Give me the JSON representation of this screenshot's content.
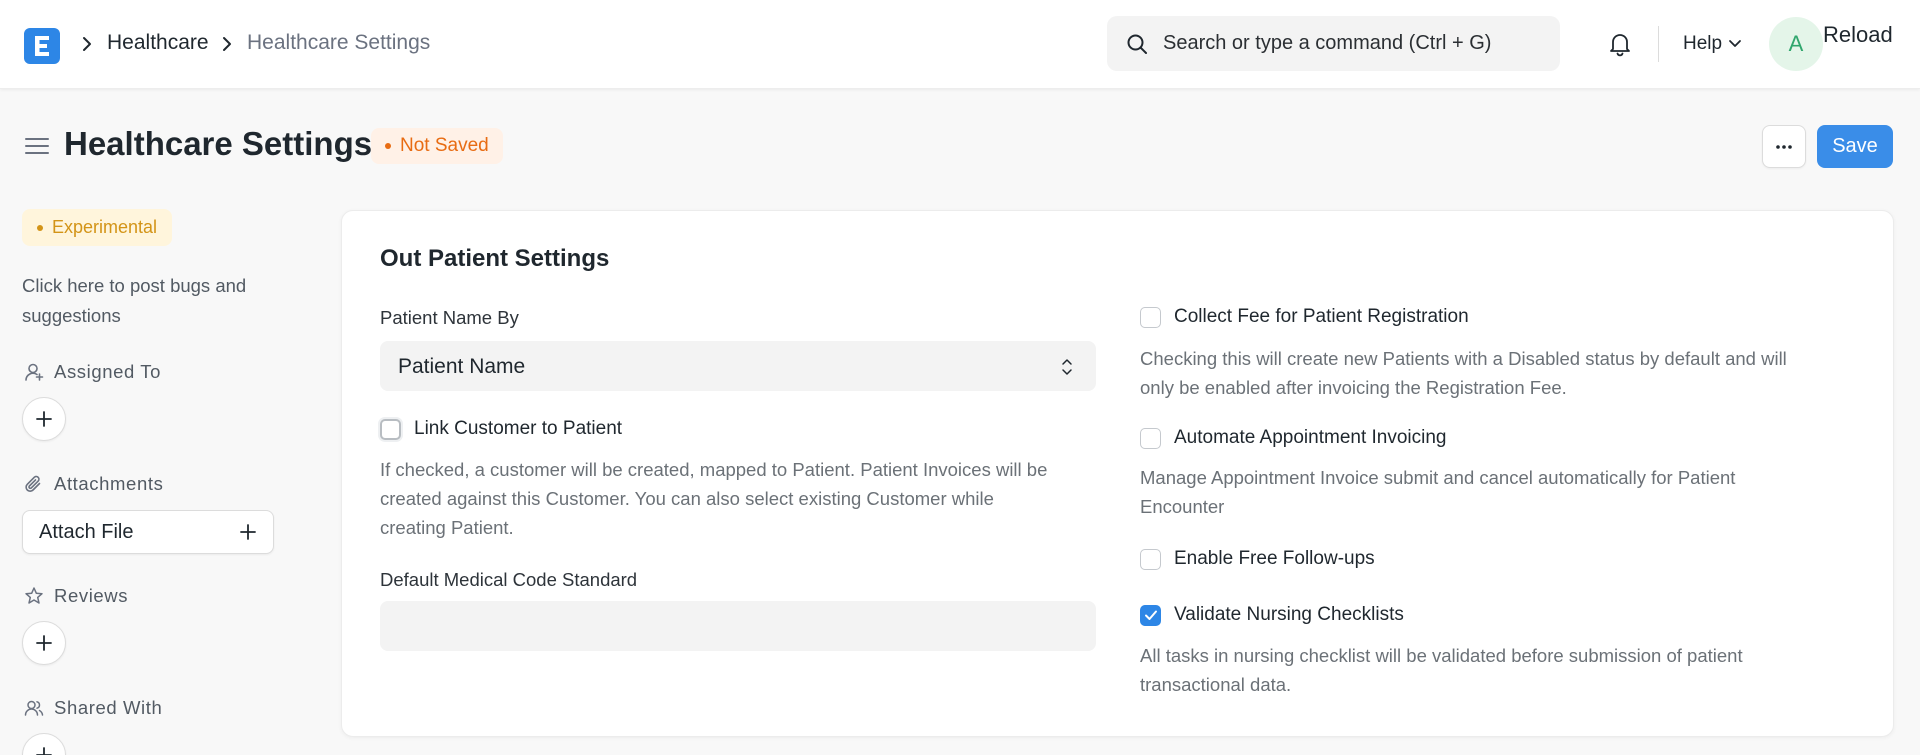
{
  "navbar": {
    "breadcrumbs": [
      "Healthcare",
      "Healthcare Settings"
    ],
    "search_placeholder": "Search or type a command (Ctrl + G)",
    "help_label": "Help",
    "avatar_initial": "A",
    "reload_label": "Reload"
  },
  "page": {
    "title": "Healthcare Settings",
    "status": "Not Saved",
    "save_label": "Save",
    "more_label": "···"
  },
  "sidebar": {
    "badge": "Experimental",
    "bug_link": "Click here to post bugs and suggestions",
    "assigned_label": "Assigned To",
    "attachments_label": "Attachments",
    "attach_button": "Attach File",
    "reviews_label": "Reviews",
    "shared_label": "Shared With"
  },
  "form": {
    "section_title": "Out Patient Settings",
    "patient_name_by": {
      "label": "Patient Name By",
      "value": "Patient Name"
    },
    "link_customer": {
      "label": "Link Customer to Patient",
      "checked": false,
      "desc": [
        "If checked, a customer will be created, mapped to Patient. Patient Invoices will be",
        "created against this Customer. You can also select existing Customer while",
        "creating Patient."
      ]
    },
    "default_code": {
      "label": "Default Medical Code Standard",
      "value": ""
    },
    "collect_fee": {
      "label": "Collect Fee for Patient Registration",
      "checked": false,
      "desc": [
        "Checking this will create new Patients with a Disabled status by default and will",
        "only be enabled after invoicing the Registration Fee."
      ]
    },
    "automate_invoicing": {
      "label": "Automate Appointment Invoicing",
      "checked": false,
      "desc": [
        "Manage Appointment Invoice submit and cancel automatically for Patient",
        "Encounter"
      ]
    },
    "free_followups": {
      "label": "Enable Free Follow-ups",
      "checked": false
    },
    "validate_nursing": {
      "label": "Validate Nursing Checklists",
      "checked": true,
      "desc": [
        "All tasks in nursing checklist will be validated before submission of patient",
        "transactional data."
      ]
    }
  },
  "colors": {
    "primary": "#2d86e6",
    "not_saved": "#e86c13",
    "experimental": "#d39417",
    "avatar": "#30a66d"
  }
}
